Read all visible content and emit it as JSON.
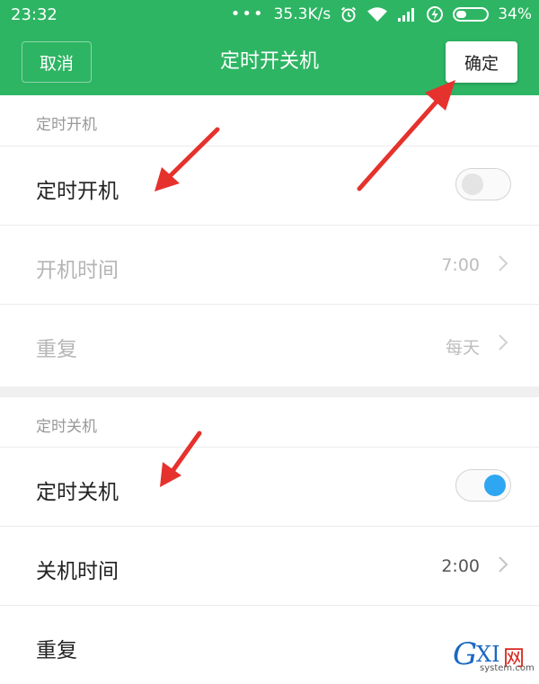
{
  "status_bar": {
    "time": "23:32",
    "dots": "•••",
    "network_speed": "35.3K/s",
    "battery_percent": "34%",
    "battery_level": 0.34,
    "icons": [
      "alarm-icon",
      "wifi-icon",
      "signal-icon",
      "charging-icon",
      "battery-icon"
    ]
  },
  "header": {
    "cancel_label": "取消",
    "title": "定时开关机",
    "confirm_label": "确定"
  },
  "power_on": {
    "section_title": "定时开机",
    "toggle_label": "定时开机",
    "toggle_on": false,
    "time_label": "开机时间",
    "time_value": "7:00",
    "repeat_label": "重复",
    "repeat_value": "每天"
  },
  "power_off": {
    "section_title": "定时关机",
    "toggle_label": "定时关机",
    "toggle_on": true,
    "time_label": "关机时间",
    "time_value": "2:00",
    "repeat_label": "重复"
  },
  "watermark": {
    "g": "G",
    "xi": "XI",
    "cn": "网",
    "url": "system.com"
  },
  "colors": {
    "header_green": "#2db563",
    "toggle_on_blue": "#2ea6f2",
    "annotation_red": "#e5322d"
  }
}
